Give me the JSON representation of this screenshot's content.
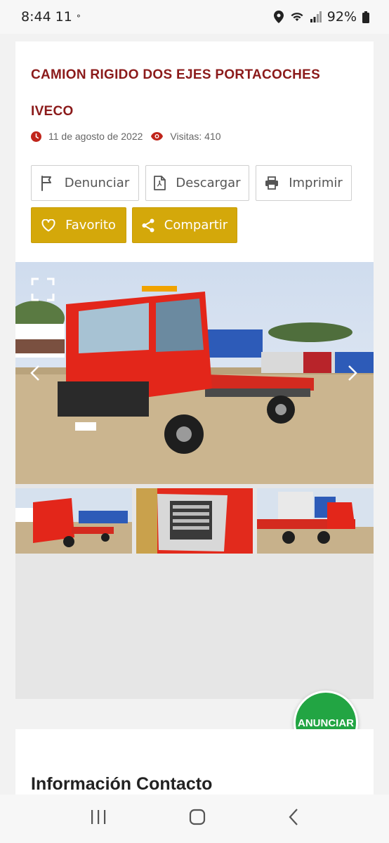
{
  "status": {
    "time": "8:44",
    "time_extra": "11",
    "battery": "92%"
  },
  "listing": {
    "title_line1": "CAMION RIGIDO DOS EJES PORTACOCHES",
    "title_line2": "IVECO",
    "date": "11 de agosto de 2022",
    "views": "Visitas: 410",
    "icons": {
      "date": "clock-icon",
      "views": "eye-icon"
    }
  },
  "actions": {
    "report": "Denunciar",
    "download": "Descargar",
    "print": "Imprimir",
    "favorite": "Favorito",
    "share": "Compartir"
  },
  "gallery": {
    "thumbs": [
      "truck-front-view",
      "manufacturer-plate",
      "truck-rear-view"
    ]
  },
  "fab": {
    "label": "ANUNCIAR"
  },
  "contact": {
    "title": "Información Contacto"
  },
  "colors": {
    "title": "#8b1a1a",
    "accent_gold": "#d4a80a",
    "fab_green": "#22a543",
    "icon_red": "#c0251b"
  }
}
